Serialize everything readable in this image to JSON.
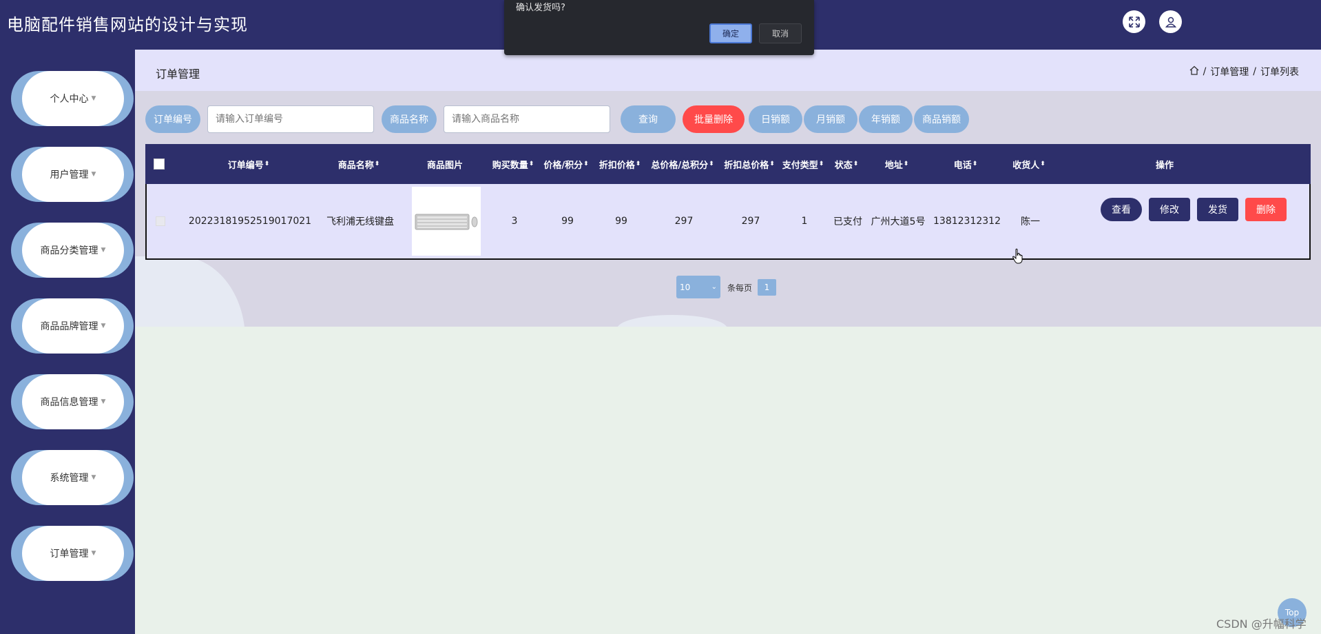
{
  "header": {
    "title": "电脑配件销售网站的设计与实现",
    "fullscreen_icon": "expand-icon",
    "user_icon": "user-icon"
  },
  "dialog": {
    "message": "确认发货吗?",
    "ok_label": "确定",
    "cancel_label": "取消"
  },
  "sidebar": {
    "items": [
      {
        "label": "个人中心"
      },
      {
        "label": "用户管理"
      },
      {
        "label": "商品分类管理"
      },
      {
        "label": "商品品牌管理"
      },
      {
        "label": "商品信息管理"
      },
      {
        "label": "系统管理"
      },
      {
        "label": "订单管理"
      }
    ]
  },
  "page": {
    "title": "订单管理",
    "breadcrumb": [
      "订单管理",
      "订单列表"
    ],
    "breadcrumb_sep": "/"
  },
  "search": {
    "order_no_label": "订单编号",
    "order_no_placeholder": "请输入订单编号",
    "product_label": "商品名称",
    "product_placeholder": "请输入商品名称",
    "query_label": "查询",
    "batch_delete_label": "批量删除",
    "daily_sales_label": "日销额",
    "monthly_sales_label": "月销额",
    "yearly_sales_label": "年销额",
    "product_sales_label": "商品销额"
  },
  "table": {
    "columns": [
      "订单编号",
      "商品名称",
      "商品图片",
      "购买数量",
      "价格/积分",
      "折扣价格",
      "总价格/总积分",
      "折扣总价格",
      "支付类型",
      "状态",
      "地址",
      "电话",
      "收货人",
      "操作"
    ],
    "rows": [
      {
        "order_no": "20223181952519017021",
        "product": "飞利浦无线键盘",
        "qty": "3",
        "price": "99",
        "discount_price": "99",
        "total": "297",
        "discount_total": "297",
        "pay_type": "1",
        "status": "已支付",
        "address": "广州大道5号",
        "phone": "13812312312",
        "receiver": "陈一",
        "actions": {
          "view": "查看",
          "edit": "修改",
          "ship": "发货",
          "delete": "删除"
        }
      }
    ]
  },
  "pagination": {
    "page_size": "10",
    "per_page_label": "条每页",
    "current_page": "1"
  },
  "top_button": "Top",
  "watermark": "CSDN @升幅科学",
  "colors": {
    "navy": "#2d2f6b",
    "light_blue": "#8ab1dc",
    "red": "#ff4a4a",
    "lavender": "#e3e2fb"
  }
}
